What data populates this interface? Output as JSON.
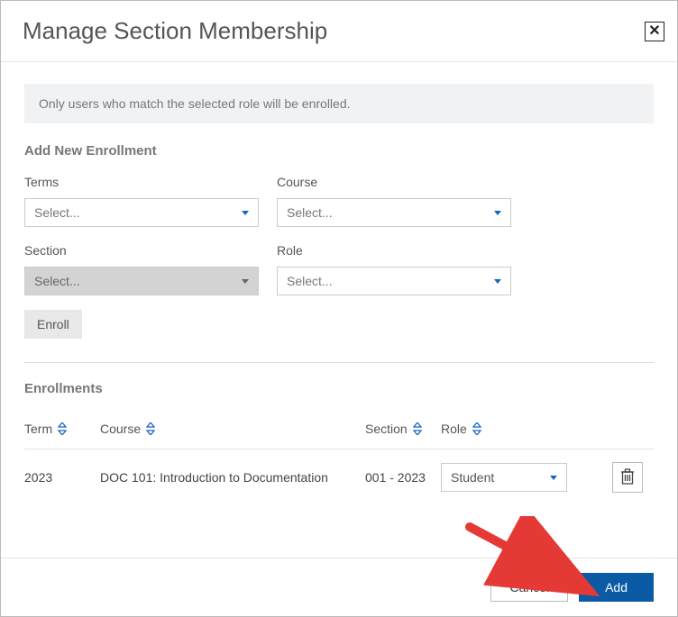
{
  "dialog": {
    "title": "Manage Section Membership"
  },
  "info": {
    "text": "Only users who match the selected role will be enrolled."
  },
  "addNew": {
    "heading": "Add New Enrollment",
    "terms": {
      "label": "Terms",
      "placeholder": "Select..."
    },
    "course": {
      "label": "Course",
      "placeholder": "Select..."
    },
    "section": {
      "label": "Section",
      "placeholder": "Select..."
    },
    "role": {
      "label": "Role",
      "placeholder": "Select..."
    },
    "enroll_label": "Enroll"
  },
  "enrollments": {
    "heading": "Enrollments",
    "columns": {
      "term": "Term",
      "course": "Course",
      "section": "Section",
      "role": "Role"
    },
    "rows": [
      {
        "term": "2023",
        "course": "DOC 101: Introduction to Documentation",
        "section": "001 - 2023",
        "role": "Student"
      }
    ]
  },
  "footer": {
    "cancel": "Cancel",
    "add": "Add"
  }
}
